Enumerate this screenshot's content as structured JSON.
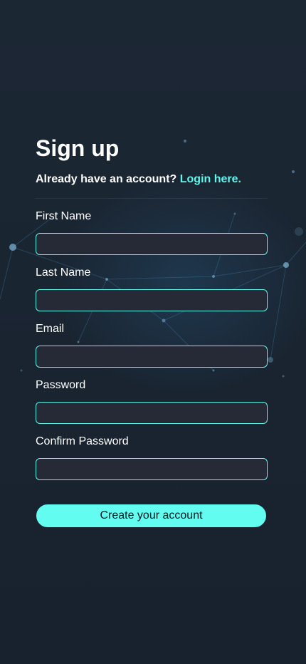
{
  "signup": {
    "title": "Sign up",
    "prompt": "Already have an account?",
    "login_link": "Login here."
  },
  "fields": {
    "first_name": {
      "label": "First Name",
      "value": ""
    },
    "last_name": {
      "label": "Last Name",
      "value": ""
    },
    "email": {
      "label": "Email",
      "value": ""
    },
    "password": {
      "label": "Password",
      "value": ""
    },
    "confirm_password": {
      "label": "Confirm Password",
      "value": ""
    }
  },
  "actions": {
    "create_label": "Create your account"
  },
  "colors": {
    "background": "#1a2532",
    "accent": "#5ef7ec",
    "input_bg": "#252a36",
    "text": "#ffffff"
  }
}
